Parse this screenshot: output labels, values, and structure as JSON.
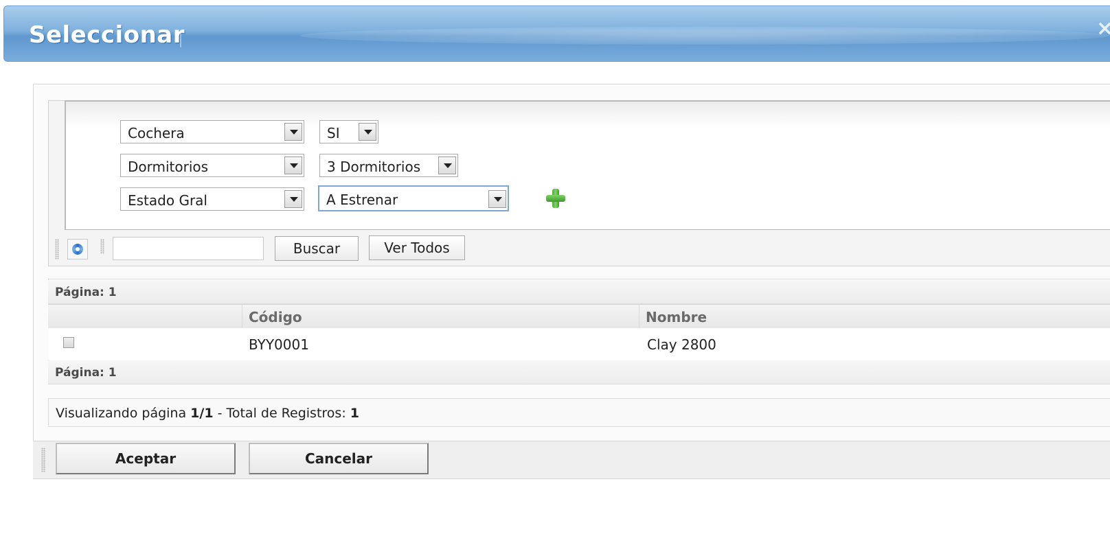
{
  "window": {
    "title": "Seleccionar",
    "close_glyph": "×"
  },
  "filters": [
    {
      "field": "Cochera",
      "value": "SI"
    },
    {
      "field": "Dormitorios",
      "value": "3 Dormitorios"
    },
    {
      "field": "Estado Gral",
      "value": "A Estrenar"
    }
  ],
  "toolbar": {
    "search_value": "",
    "search_button": "Buscar",
    "view_all_button": "Ver Todos",
    "refresh_icon": "refresh-icon",
    "add_icon": "add-filter-icon"
  },
  "grid": {
    "page_label_top": "Página: 1",
    "page_label_bottom": "Página: 1",
    "columns": [
      "",
      "Código",
      "Nombre"
    ],
    "rows": [
      {
        "checked": false,
        "codigo": "BYY0001",
        "nombre": "Clay 2800"
      }
    ]
  },
  "status": {
    "prefix": "Visualizando página ",
    "page": "1/1",
    "middle": " - Total de Registros: ",
    "total": "1"
  },
  "footer": {
    "accept": "Aceptar",
    "cancel": "Cancelar"
  }
}
